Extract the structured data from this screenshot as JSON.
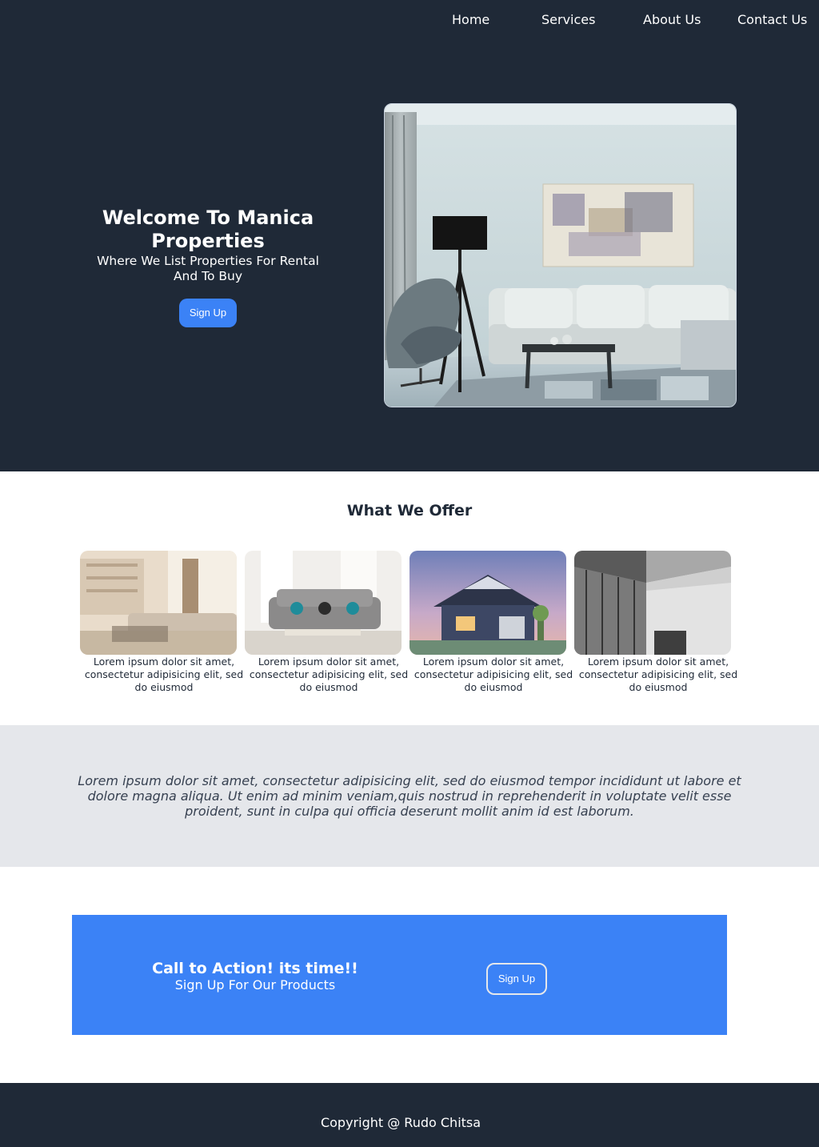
{
  "nav": {
    "items": [
      {
        "label": "Home"
      },
      {
        "label": "Services"
      },
      {
        "label": "About Us"
      },
      {
        "label": "Contact Us"
      }
    ]
  },
  "hero": {
    "title": "Welcome To Manica Properties",
    "subtitle": "Where We List Properties For Rental And To Buy",
    "button_label": "Sign Up",
    "image_alt": "living-room-photo"
  },
  "offer": {
    "title": "What We Offer",
    "cards": [
      {
        "image": "luxury-living-room-photo",
        "text": "Lorem ipsum dolor sit amet, consectetur adipisicing elit, sed do eiusmod"
      },
      {
        "image": "sofa-lounge-photo",
        "text": "Lorem ipsum dolor sit amet, consectetur adipisicing elit, sed do eiusmod"
      },
      {
        "image": "house-exterior-photo",
        "text": "Lorem ipsum dolor sit amet, consectetur adipisicing elit, sed do eiusmod"
      },
      {
        "image": "modern-building-photo",
        "text": "Lorem ipsum dolor sit amet, consectetur adipisicing elit, sed do eiusmod"
      }
    ]
  },
  "quote": {
    "text": "Lorem ipsum dolor sit amet, consectetur adipisicing elit, sed do eiusmod tempor incididunt ut labore et dolore magna aliqua. Ut enim ad minim veniam,quis nostrud in reprehenderit in voluptate velit esse proident, sunt in culpa qui officia deserunt mollit anim id est laborum."
  },
  "cta": {
    "title": "Call to Action! its time!!",
    "subtitle": "Sign Up For Our Products",
    "button_label": "Sign Up"
  },
  "footer": {
    "text": "Copyright @ Rudo Chitsa"
  },
  "colors": {
    "dark": "#1f2937",
    "accent": "#3b82f6",
    "light_gray": "#e5e7eb"
  }
}
